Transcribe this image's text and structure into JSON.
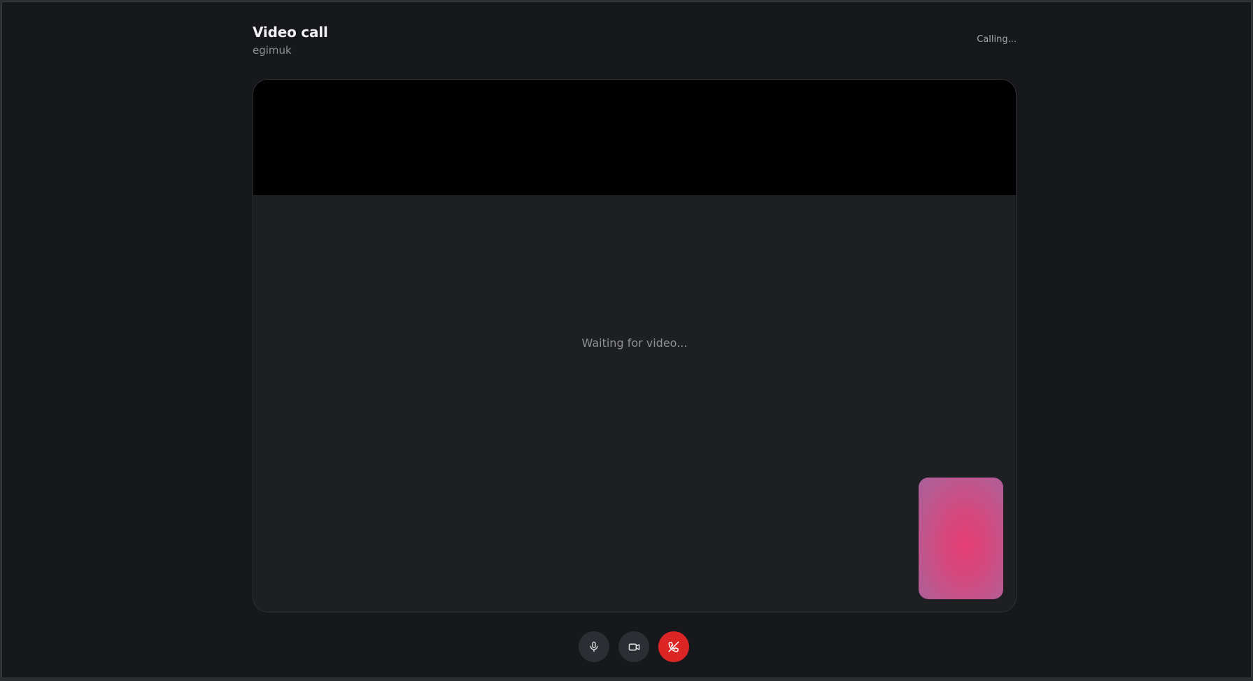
{
  "header": {
    "title": "Video call",
    "subtitle": "egimuk",
    "status": "Calling..."
  },
  "stage": {
    "waiting_text": "Waiting for video..."
  },
  "controls": {
    "mic_icon": "microphone-icon",
    "camera_icon": "video-camera-icon",
    "end_icon": "phone-hangup-icon"
  },
  "colors": {
    "background": "#17181b",
    "stage": "#1e1f23",
    "control": "#2d2e33",
    "end_call": "#dc2626",
    "self_view": "#e63e75"
  }
}
